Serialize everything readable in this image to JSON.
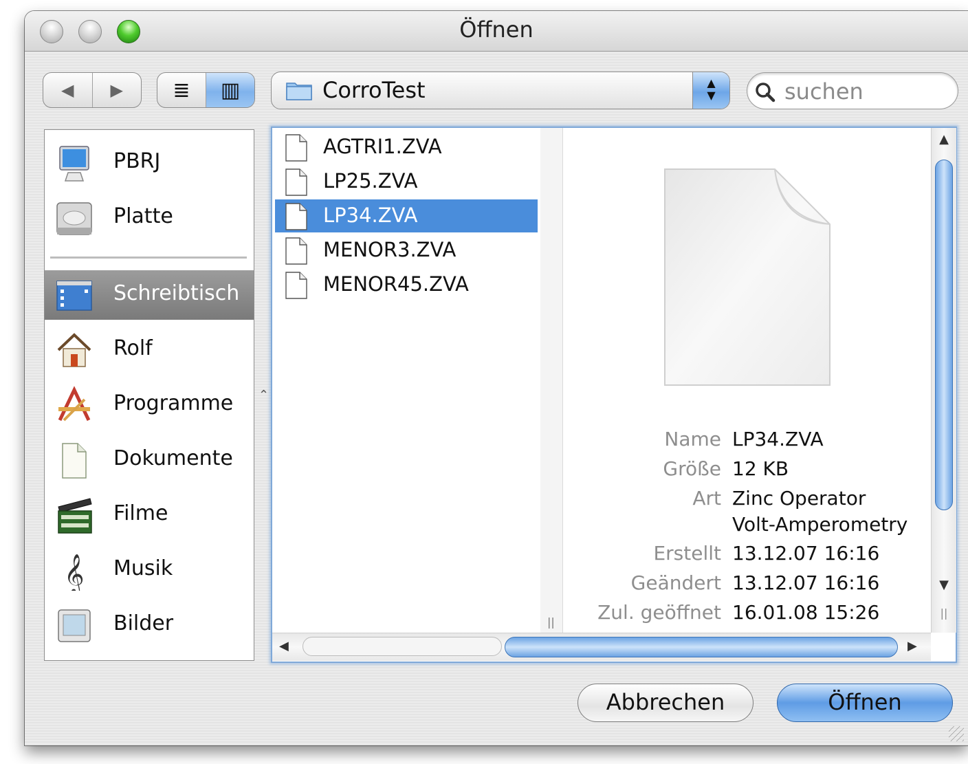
{
  "window": {
    "title": "Öffnen"
  },
  "toolbar": {
    "back_glyph": "◀",
    "forward_glyph": "▶",
    "list_view_glyph": "≣",
    "column_view_glyph": "▥",
    "location": "CorroTest",
    "search_placeholder": "suchen"
  },
  "sidebar": {
    "devices": [
      {
        "label": "PBRJ",
        "icon": "computer-icon"
      },
      {
        "label": "Platte",
        "icon": "hard-disk-icon"
      }
    ],
    "places": [
      {
        "label": "Schreibtisch",
        "icon": "desktop-icon",
        "selected": true
      },
      {
        "label": "Rolf",
        "icon": "home-icon"
      },
      {
        "label": "Programme",
        "icon": "applications-icon"
      },
      {
        "label": "Dokumente",
        "icon": "documents-icon"
      },
      {
        "label": "Filme",
        "icon": "movies-icon"
      },
      {
        "label": "Musik",
        "icon": "music-icon"
      },
      {
        "label": "Bilder",
        "icon": "pictures-icon"
      }
    ]
  },
  "files": [
    {
      "name": "AGTRI1.ZVA",
      "selected": false
    },
    {
      "name": "LP25.ZVA",
      "selected": false
    },
    {
      "name": "LP34.ZVA",
      "selected": true
    },
    {
      "name": "MENOR3.ZVA",
      "selected": false
    },
    {
      "name": "MENOR45.ZVA",
      "selected": false
    }
  ],
  "preview": {
    "name_label": "Name",
    "name": "LP34.ZVA",
    "size_label": "Größe",
    "size": "12 KB",
    "kind_label": "Art",
    "kind_line1": "Zinc Operator",
    "kind_line2": "Volt-Amperometry",
    "created_label": "Erstellt",
    "created": "13.12.07 16:16",
    "modified_label": "Geändert",
    "modified": "13.12.07 16:16",
    "opened_label": "Zul. geöffnet",
    "opened": "16.01.08 15:26"
  },
  "buttons": {
    "cancel": "Abbrechen",
    "open": "Öffnen"
  },
  "colors": {
    "selection": "#4a8ddb",
    "aqua": "#6ca3e3",
    "sidebar_selection": "#8a8a8a"
  }
}
